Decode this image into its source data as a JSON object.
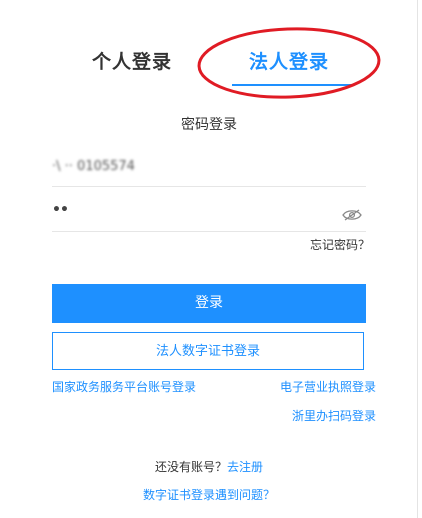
{
  "tabs": [
    {
      "label": "个人登录",
      "active": false
    },
    {
      "label": "法人登录",
      "active": true
    }
  ],
  "login_mode_title": "密码登录",
  "account_field": {
    "value": "·\\ ·· 0105574"
  },
  "password_field": {
    "value": "••"
  },
  "password_visibility_icon": "eye-slash-icon",
  "forgot_password": "忘记密码？",
  "login_button": "登录",
  "cert_login_button": "法人数字证书登录",
  "links": {
    "gov_platform": "国家政务服务平台账号登录",
    "business_license": "电子营业执照登录",
    "zheli_scan": "浙里办扫码登录"
  },
  "signup": {
    "prompt": "还没有账号？",
    "link": "去注册"
  },
  "cert_help": "数字证书登录遇到问题？",
  "colors": {
    "accent": "#1e90ff",
    "annotation": "#e01b24"
  }
}
